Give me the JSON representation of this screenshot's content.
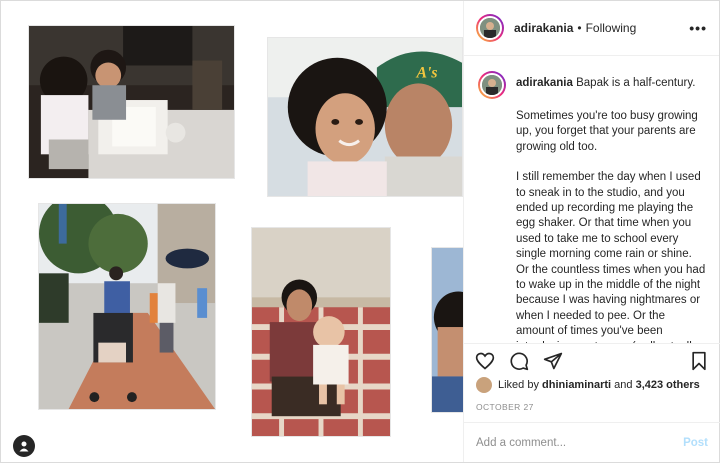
{
  "post": {
    "username": "adirakania",
    "follow_status": "Following",
    "separator": "•",
    "more_label": "•••"
  },
  "caption": {
    "username": "adirakania",
    "first_line": "Bapak is a half-century.",
    "paragraphs": [
      "Sometimes you're too busy growing up, you forget that your parents are growing old too.",
      "I still remember the day when I used to sneak in to the studio, and you ended up recording me playing the egg shaker. Or that time when you used to take me to school every single morning come rain or shine. Or the countless times when you had to wake up in the middle of the night because I was having nightmares or when I needed to pee. Or the amount of times you've been introducing me to new (well actually old) songs and artists. Now that I think of it, every hobby that I have started with you."
    ]
  },
  "likes": {
    "prefix": "Liked by",
    "user": "dhiniaminarti",
    "and": "and",
    "count": "3,423 others"
  },
  "date": "OCTOBER 27",
  "comment": {
    "placeholder": "Add a comment...",
    "post_label": "Post"
  },
  "icons": {
    "like": "heart-icon",
    "comment": "comment-icon",
    "share": "share-icon",
    "save": "bookmark-icon",
    "tags": "user-tag-icon"
  },
  "colors": {
    "avatar_ring": [
      "#f9ce34",
      "#ee2a7b",
      "#6228d7"
    ],
    "post_button": "#b2dffc",
    "muted": "#8e8e8e"
  }
}
